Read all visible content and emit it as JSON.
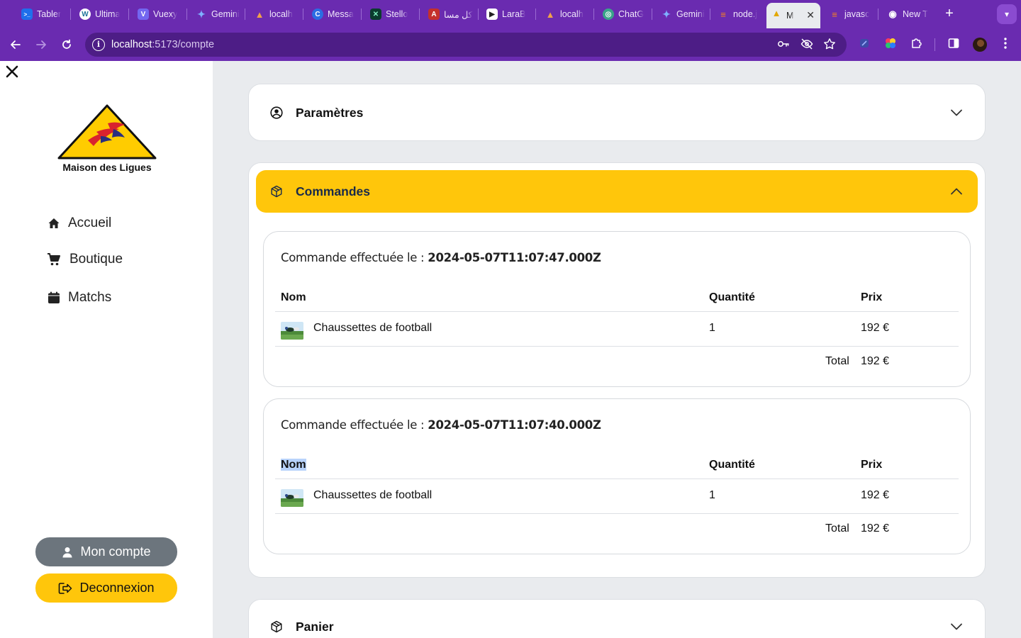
{
  "browser": {
    "tabs": [
      {
        "title": "Tabler",
        "fav_color": "#1f6feb",
        "fav_glyph": ">_"
      },
      {
        "title": "Ultima",
        "fav_color": "#21759b",
        "fav_glyph": "W"
      },
      {
        "title": "Vuexy",
        "fav_color": "#7367f0",
        "fav_glyph": "V"
      },
      {
        "title": "Gemini",
        "fav_color": "#4a7ee8",
        "fav_glyph": "✦"
      },
      {
        "title": "localh",
        "fav_color": "#c9752b",
        "fav_glyph": "▲"
      },
      {
        "title": "Messa",
        "fav_color": "#2b6de3",
        "fav_glyph": "C"
      },
      {
        "title": "Stello",
        "fav_color": "#0b3b2e",
        "fav_glyph": "✕"
      },
      {
        "title": "كل مسا",
        "fav_color": "#c4302b",
        "fav_glyph": "A"
      },
      {
        "title": "LaraB",
        "fav_color": "#ffffff",
        "fav_glyph": "▶"
      },
      {
        "title": "localh",
        "fav_color": "#c9752b",
        "fav_glyph": "▲"
      },
      {
        "title": "ChatG",
        "fav_color": "#3aa48a",
        "fav_glyph": "◎"
      },
      {
        "title": "Gemini",
        "fav_color": "#4a7ee8",
        "fav_glyph": "✦"
      },
      {
        "title": "node.j",
        "fav_color": "#e8744b",
        "fav_glyph": "≡"
      },
      {
        "title": "M",
        "fav_color": "#ffc60b",
        "fav_glyph": "▲"
      },
      {
        "title": "javasc",
        "fav_color": "#e8744b",
        "fav_glyph": "≡"
      },
      {
        "title": "New T",
        "fav_color": "#ffffff",
        "fav_glyph": "◉"
      }
    ],
    "url_host": "localhost",
    "url_path": ":5173/compte"
  },
  "sidebar": {
    "brand": "Maison des Ligues",
    "nav": [
      {
        "label": "Accueil",
        "icon": "home-icon"
      },
      {
        "label": "Boutique",
        "icon": "cart-icon"
      },
      {
        "label": "Matchs",
        "icon": "calendar-icon"
      }
    ],
    "account_label": "Mon compte",
    "logout_label": "Deconnexion"
  },
  "main": {
    "sections": {
      "settings": {
        "label": "Paramètres",
        "icon": "user-circle-icon",
        "open": false
      },
      "orders": {
        "label": "Commandes",
        "icon": "package-icon",
        "open": true
      },
      "cart": {
        "label": "Panier",
        "icon": "package-icon",
        "open": false
      }
    },
    "orders_header": {
      "date_prefix": "Commande effectuée le :",
      "col_name": "Nom",
      "col_qty": "Quantité",
      "col_price": "Prix",
      "total_label": "Total"
    },
    "orders": [
      {
        "date": "2024-05-07T11:07:47.000Z",
        "items": [
          {
            "name": "Chaussettes de football",
            "qty": "1",
            "price": "192 €"
          }
        ],
        "total": "192 €"
      },
      {
        "date": "2024-05-07T11:07:40.000Z",
        "items": [
          {
            "name": "Chaussettes de football",
            "qty": "1",
            "price": "192 €"
          }
        ],
        "total": "192 €"
      }
    ]
  },
  "colors": {
    "accent": "#ffc60b",
    "chrome": "#6a2bb0",
    "account_button": "#6c757d"
  }
}
